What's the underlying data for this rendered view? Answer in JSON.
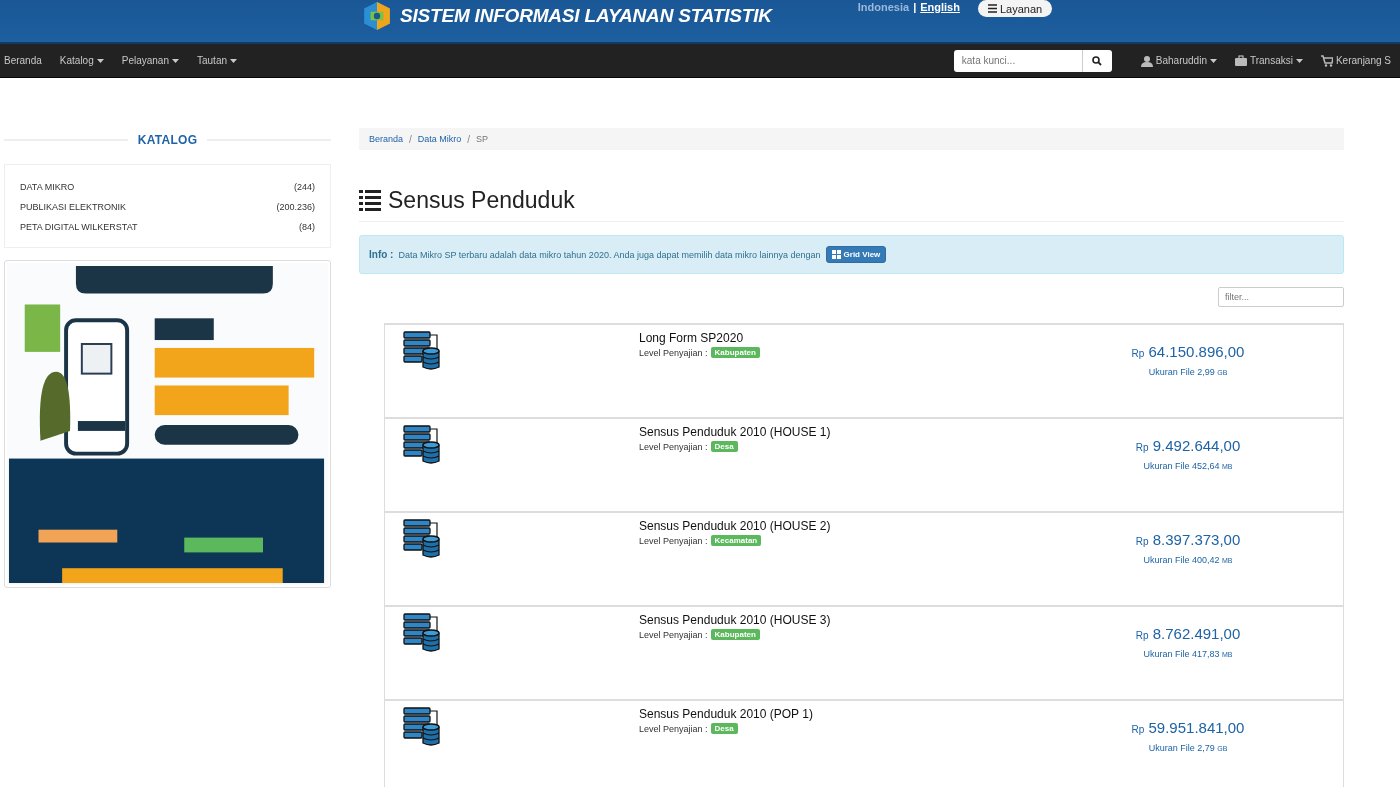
{
  "header": {
    "title": "SISTEM INFORMASI LAYANAN STATISTIK",
    "languages": [
      {
        "label": "Indonesia",
        "selected": false
      },
      {
        "label": "English",
        "selected": true
      }
    ],
    "language_separator": "|",
    "menu_button": "Layanan"
  },
  "navbar": {
    "items": [
      {
        "label": "Beranda",
        "has_menu": false
      },
      {
        "label": "Katalog",
        "has_menu": true
      },
      {
        "label": "Pelayanan",
        "has_menu": true
      },
      {
        "label": "Tautan",
        "has_menu": true
      }
    ],
    "search": {
      "placeholder": "kata kunci..."
    },
    "right_items": [
      {
        "kind": "user",
        "label": "Baharuddin",
        "has_menu": true
      },
      {
        "kind": "briefcase",
        "label": "Transaksi",
        "has_menu": true
      },
      {
        "kind": "cart",
        "label": "Keranjang S",
        "has_menu": false
      }
    ]
  },
  "sidebar": {
    "heading": "KATALOG",
    "items": [
      {
        "label": "DATA MIKRO",
        "count": "(244)"
      },
      {
        "label": "PUBLIKASI ELEKTRONIK",
        "count": "(200.236)"
      },
      {
        "label": "PETA DIGITAL WILKERSTAT",
        "count": "(84)"
      }
    ]
  },
  "breadcrumb": [
    {
      "kind": "link",
      "text": "Beranda"
    },
    {
      "kind": "separator",
      "text": "/"
    },
    {
      "kind": "link",
      "text": "Data Mikro"
    },
    {
      "kind": "separator",
      "text": "/"
    },
    {
      "kind": "current",
      "text": "SP"
    }
  ],
  "page_title": "Sensus Penduduk",
  "info": {
    "label": "Info :",
    "text": "Data Mikro SP terbaru adalah data mikro tahun 2020. Anda juga dapat memilih data mikro lainnya dengan",
    "button": "Grid View"
  },
  "filter": {
    "placeholder": "filter..."
  },
  "products": [
    {
      "title": "Long Form SP2020",
      "level_label": "Level Penyajian :",
      "level": "Kabupaten",
      "currency": "Rp",
      "price": "64.150.896,00",
      "size_label": "Ukuran File 2,99",
      "size_unit": "GB"
    },
    {
      "title": "Sensus Penduduk 2010 (HOUSE 1)",
      "level_label": "Level Penyajian :",
      "level": "Desa",
      "currency": "Rp",
      "price": "9.492.644,00",
      "size_label": "Ukuran File 452,64",
      "size_unit": "MB"
    },
    {
      "title": "Sensus Penduduk 2010 (HOUSE 2)",
      "level_label": "Level Penyajian :",
      "level": "Kecamatan",
      "currency": "Rp",
      "price": "8.397.373,00",
      "size_label": "Ukuran File 400,42",
      "size_unit": "MB"
    },
    {
      "title": "Sensus Penduduk 2010 (HOUSE 3)",
      "level_label": "Level Penyajian :",
      "level": "Kabupaten",
      "currency": "Rp",
      "price": "8.762.491,00",
      "size_label": "Ukuran File 417,83",
      "size_unit": "MB"
    },
    {
      "title": "Sensus Penduduk 2010 (POP 1)",
      "level_label": "Level Penyajian :",
      "level": "Desa",
      "currency": "Rp",
      "price": "59.951.841,00",
      "size_label": "Ukuran File 2,79",
      "size_unit": "GB"
    }
  ]
}
